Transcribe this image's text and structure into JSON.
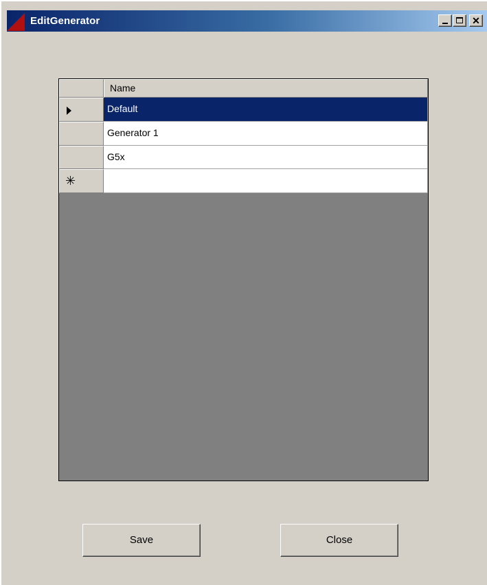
{
  "window": {
    "title": "EditGenerator",
    "minimize_label": "_",
    "maximize_label": "□",
    "close_label": "✕"
  },
  "grid": {
    "columns": [
      "Name"
    ],
    "rows": [
      {
        "name": "Default",
        "selected": true,
        "marker": "current"
      },
      {
        "name": "Generator 1",
        "selected": false,
        "marker": ""
      },
      {
        "name": "G5x",
        "selected": false,
        "marker": ""
      },
      {
        "name": "",
        "selected": false,
        "marker": "new"
      }
    ],
    "new_row_marker": "✳"
  },
  "buttons": {
    "save": "Save",
    "close": "Close"
  },
  "colors": {
    "selection": "#0a246a",
    "dialog_bg": "#d4d0c8",
    "grid_bg": "#808080"
  }
}
